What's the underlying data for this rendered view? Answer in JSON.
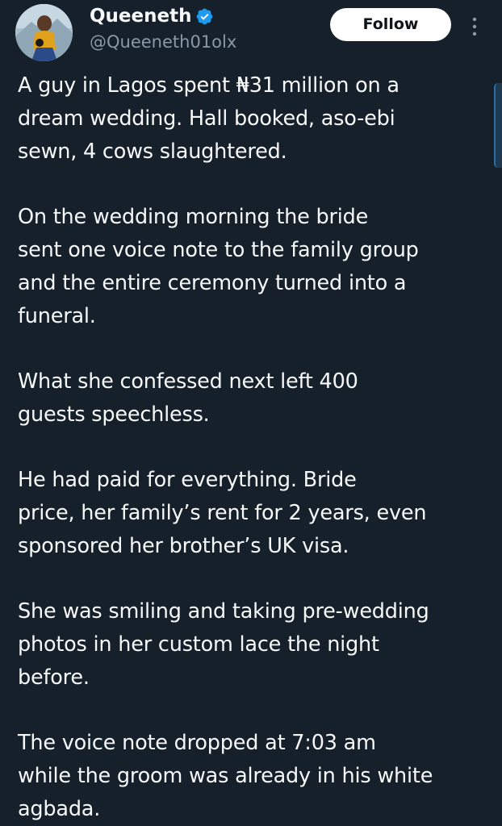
{
  "author": {
    "display_name": "Queeneth",
    "handle": "@Queeneth01olx",
    "verified": true
  },
  "follow_button": {
    "label": "Follow"
  },
  "more_icon": "more-vertical-icon",
  "colors": {
    "background": "#15202b",
    "text": "#f7f9f9",
    "secondary_text": "#8b98a5",
    "verified_blue": "#1d9bf0",
    "follow_bg": "#ffffff"
  },
  "tweet": {
    "paragraphs": [
      [
        "A guy in Lagos spent ₦31 million on a",
        "dream wedding. Hall booked, aso-ebi",
        "sewn, 4 cows slaughtered."
      ],
      [
        "On the wedding morning the bride",
        "sent one voice note to the family group",
        "and the entire ceremony turned into a",
        "funeral."
      ],
      [
        "What she confessed next left 400",
        "guests speechless."
      ],
      [
        "He had paid for everything. Bride",
        "price, her family’s rent for 2 years, even",
        "sponsored her brother’s UK visa."
      ],
      [
        "She was smiling and taking pre-wedding",
        "photos in her custom lace the night",
        "before."
      ],
      [
        "The voice note dropped at 7:03 am",
        "while the groom was already in his white",
        "agbada."
      ]
    ]
  }
}
